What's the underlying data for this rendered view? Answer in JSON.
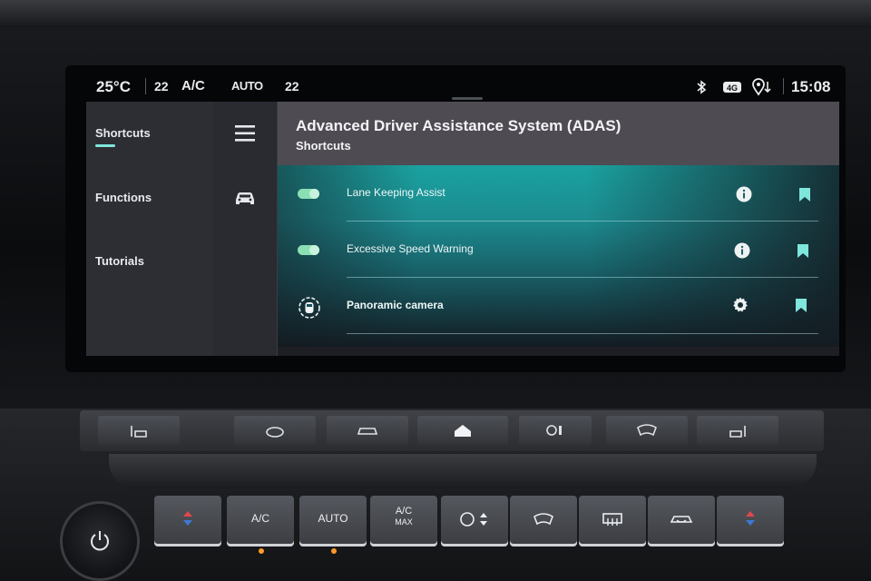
{
  "status_bar": {
    "outside_temp": "25°C",
    "left_temp": "22",
    "ac_label": "A/C",
    "auto_label": "AUTO",
    "right_temp": "22",
    "clock": "15:08",
    "icons": [
      "bluetooth-icon",
      "4g-icon",
      "location-icon"
    ]
  },
  "nav": {
    "items": [
      {
        "label": "Shortcuts",
        "active": true
      },
      {
        "label": "Functions",
        "active": false
      },
      {
        "label": "Tutorials",
        "active": false
      }
    ]
  },
  "icon_bar": {
    "icons": [
      "menu-icon",
      "car-icon"
    ]
  },
  "header": {
    "title": "Advanced Driver Assistance System (ADAS)",
    "subtitle": "Shortcuts"
  },
  "rows": [
    {
      "label": "Lane Keeping Assist",
      "control": "toggle",
      "toggle_on": true,
      "action_icon": "info-icon",
      "bookmarked": true
    },
    {
      "label": "Excessive Speed Warning",
      "control": "toggle",
      "toggle_on": true,
      "action_icon": "info-icon",
      "bookmarked": true
    },
    {
      "label": "Panoramic camera",
      "control": "camera-icon",
      "action_icon": "gear-icon",
      "bookmarked": true
    }
  ],
  "physical_keys": {
    "ac": "A/C",
    "auto": "AUTO",
    "ac_max_top": "A/C",
    "ac_max_bottom": "MAX"
  },
  "colors": {
    "accent": "#7fe6dc",
    "toggle_on": "#8be0b3",
    "header_bg": "#4e4b53",
    "led": "#ff9a2a"
  }
}
